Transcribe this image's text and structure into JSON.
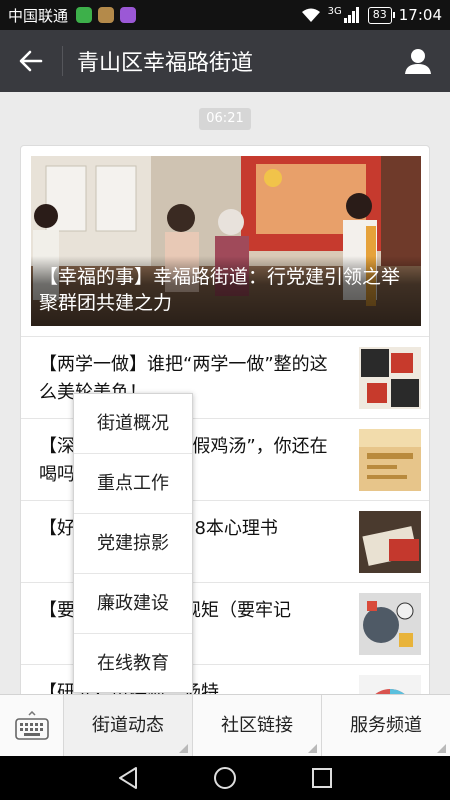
{
  "status_bar": {
    "carrier": "中国联通",
    "network": "3G",
    "battery": "83",
    "time": "17:04"
  },
  "header": {
    "title": "青山区幸福路街道",
    "back_icon": "arrow-left-icon",
    "profile_icon": "person-icon",
    "bg_color": "#393a3f"
  },
  "message_time": "06:21",
  "articles": {
    "hero": {
      "title": "【幸福的事】幸福路街道：行党建引领之举 聚群团共建之力"
    },
    "items": [
      {
        "title": "【两学一做】谁把“两学一做”整的这么美轮美奂！"
      },
      {
        "title": "【深度】这些都是“假鸡汤”，你还在喝吗？"
      },
      {
        "title": "【好书】为自己的18本心理书"
      },
      {
        "title": "【要牢记】成文的规矩（要牢记"
      },
      {
        "title": "【研究】蛋糕师、汤特"
      }
    ]
  },
  "popup_menu": {
    "items": [
      "街道概况",
      "重点工作",
      "党建掠影",
      "廉政建设",
      "在线教育"
    ]
  },
  "menu_bar": {
    "keyboard_icon": "keyboard-icon",
    "buttons": [
      "街道动态",
      "社区链接",
      "服务频道"
    ]
  },
  "nav_bar": {
    "back_icon": "triangle-back-icon",
    "home_icon": "circle-home-icon",
    "recent_icon": "square-recent-icon"
  }
}
